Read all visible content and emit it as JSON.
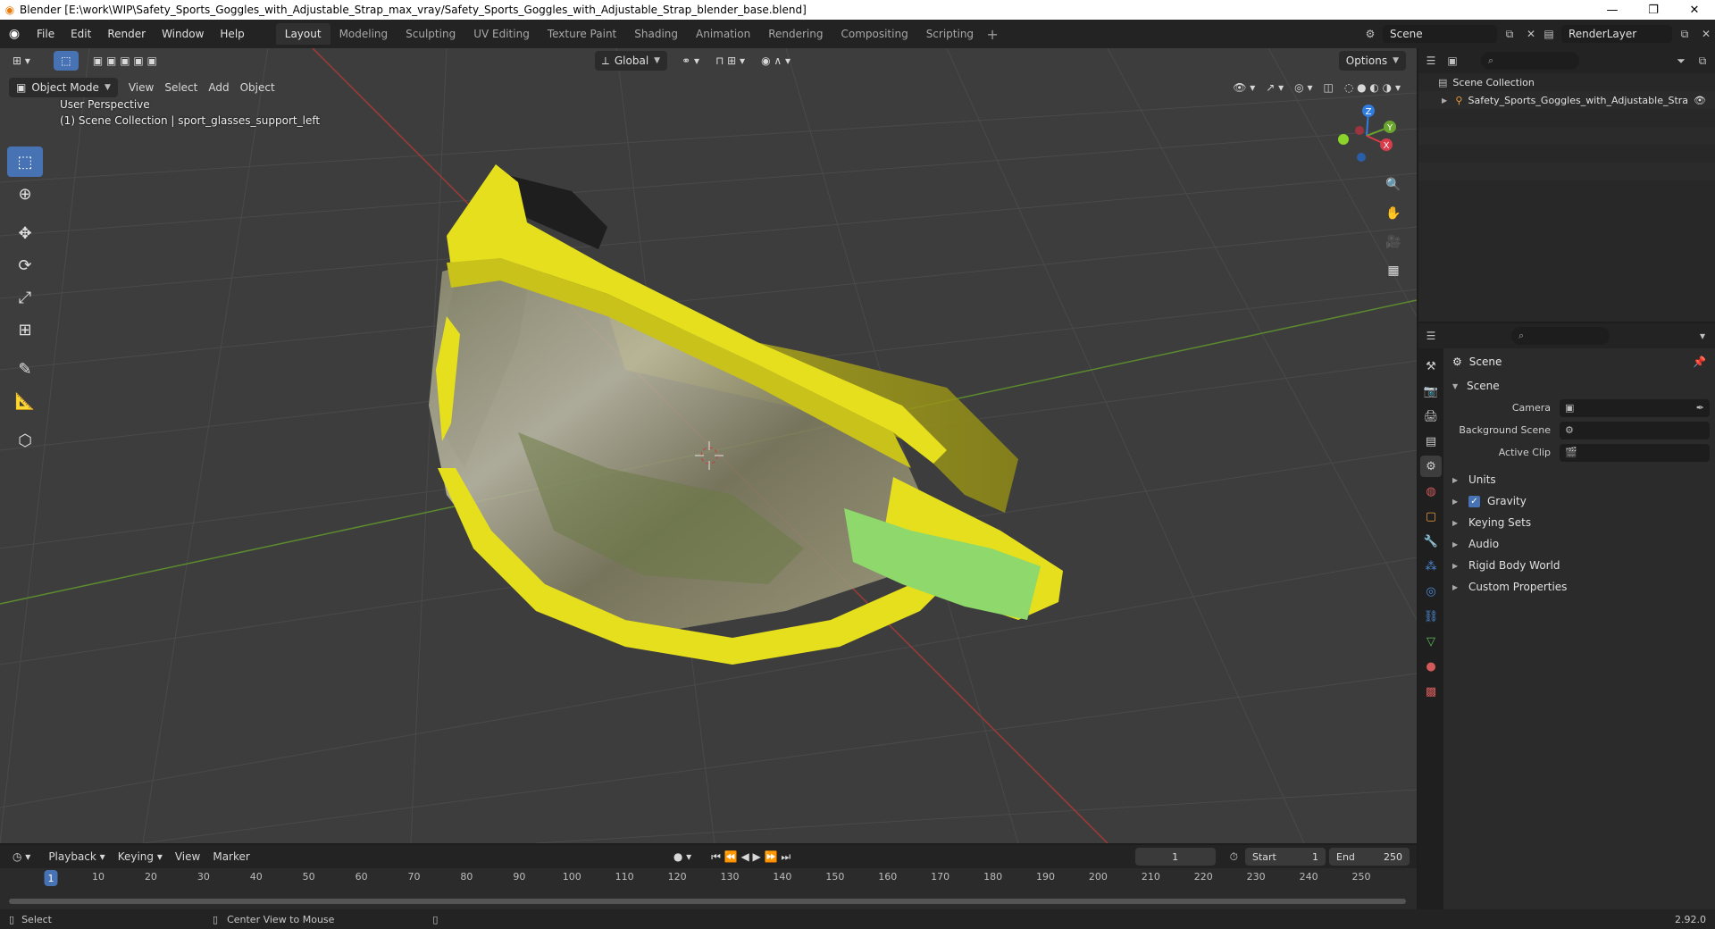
{
  "window": {
    "title": "Blender [E:\\work\\WIP\\Safety_Sports_Goggles_with_Adjustable_Strap_max_vray/Safety_Sports_Goggles_with_Adjustable_Strap_blender_base.blend]",
    "minimize": "—",
    "restore": "❐",
    "close": "✕"
  },
  "menu": [
    "File",
    "Edit",
    "Render",
    "Window",
    "Help"
  ],
  "workspaces": [
    "Layout",
    "Modeling",
    "Sculpting",
    "UV Editing",
    "Texture Paint",
    "Shading",
    "Animation",
    "Rendering",
    "Compositing",
    "Scripting"
  ],
  "active_workspace": "Layout",
  "scene_selector": "Scene",
  "render_layer": "RenderLayer",
  "viewport": {
    "transform_orientation": "Global",
    "options_label": "Options",
    "mode": "Object Mode",
    "header_menus": [
      "View",
      "Select",
      "Add",
      "Object"
    ],
    "perspective_label": "User Perspective",
    "collection_label": "(1) Scene Collection | sport_glasses_support_left",
    "gizmo_axes": [
      "Z",
      "Y",
      "X"
    ]
  },
  "outliner": {
    "root": "Scene Collection",
    "items": [
      "Safety_Sports_Goggles_with_Adjustable_Stra"
    ]
  },
  "properties": {
    "title": "Scene",
    "section": "Scene",
    "fields": [
      {
        "label": "Camera",
        "value": ""
      },
      {
        "label": "Background Scene",
        "value": ""
      },
      {
        "label": "Active Clip",
        "value": ""
      }
    ],
    "panels": [
      "Units",
      "Gravity",
      "Keying Sets",
      "Audio",
      "Rigid Body World",
      "Custom Properties"
    ],
    "gravity_checked": true
  },
  "timeline": {
    "menus": [
      "Playback",
      "Keying",
      "View",
      "Marker"
    ],
    "current_frame": "1",
    "start_label": "Start",
    "start": "1",
    "end_label": "End",
    "end": "250",
    "ticks": [
      "1",
      "10",
      "20",
      "30",
      "40",
      "50",
      "60",
      "70",
      "80",
      "90",
      "100",
      "110",
      "120",
      "130",
      "140",
      "150",
      "160",
      "170",
      "180",
      "190",
      "200",
      "210",
      "220",
      "230",
      "240",
      "250"
    ]
  },
  "statusbar": {
    "left_action": "Select",
    "middle_action": "Center View to Mouse",
    "version": "2.92.0"
  },
  "colors": {
    "accent": "#4772b3",
    "goggle_frame": "#e6df1d",
    "goggle_green": "#8fd86b"
  }
}
